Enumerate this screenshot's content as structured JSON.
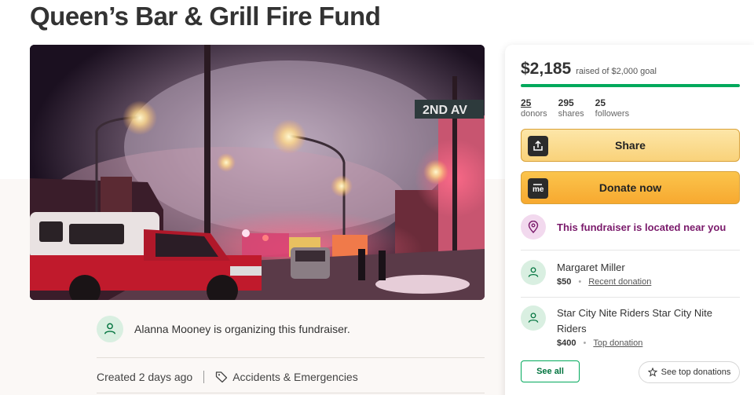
{
  "page": {
    "title": "Queen’s Bar & Grill Fire Fund"
  },
  "hero": {
    "street_sign": "2ND AV"
  },
  "organizer": {
    "text": "Alanna Mooney is organizing this fundraiser.",
    "icon": "user-heart-icon"
  },
  "meta": {
    "created": "Created 2 days ago",
    "category": "Accidents & Emergencies",
    "category_icon": "tag-icon"
  },
  "donate_card": {
    "raised": "$2,185",
    "goal_text": "raised of $2,000 goal",
    "progress_fraction": 1.0,
    "stats": [
      {
        "value": "25",
        "label": "donors"
      },
      {
        "value": "295",
        "label": "shares"
      },
      {
        "value": "25",
        "label": "followers"
      }
    ],
    "share_label": "Share",
    "share_icon": "share-upload-icon",
    "donate_label": "Donate now",
    "donate_icon": "gofundme-logo-icon",
    "location_text": "This fundraiser is located near you",
    "location_icon": "map-pin-icon",
    "donations": [
      {
        "name": "Margaret Miller",
        "amount": "$50",
        "tag": "Recent donation"
      },
      {
        "name": "Star City Nite Riders Star City Nite Riders",
        "amount": "$400",
        "tag": "Top donation"
      }
    ],
    "see_all_label": "See all",
    "see_top_label": "See top donations",
    "see_top_icon": "star-outline-icon"
  },
  "colors": {
    "accent_green": "#02a95c",
    "donate_orange": "#f7a930",
    "location_purple": "#7a1a6b"
  }
}
